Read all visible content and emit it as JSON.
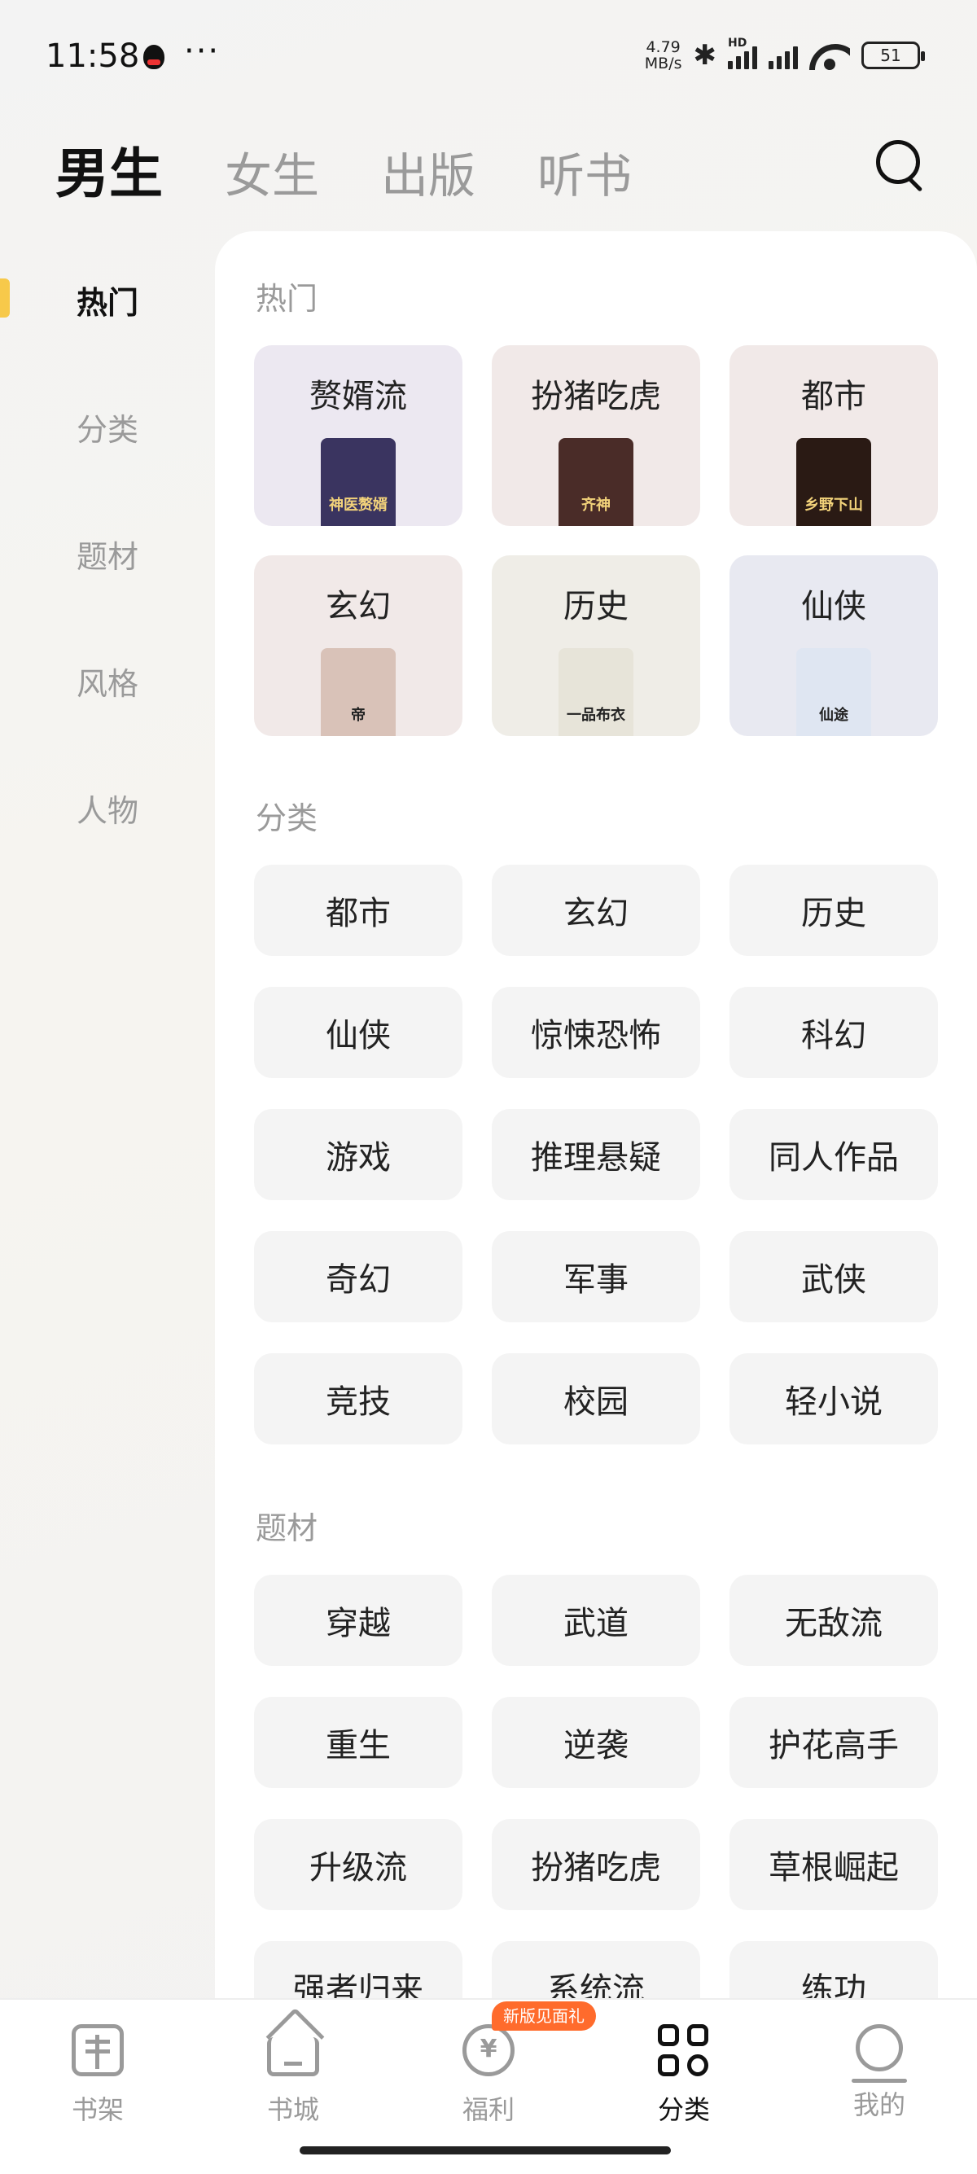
{
  "status_bar": {
    "time": "11:58",
    "dots": "···",
    "net_speed_value": "4.79",
    "net_speed_unit": "MB/s",
    "signal_badge": "HD",
    "battery": "51",
    "icons": [
      "qq-icon",
      "bluetooth-icon",
      "signal-icon",
      "wifi-icon",
      "battery-icon"
    ]
  },
  "channel_tabs": [
    {
      "label": "男生",
      "active": true
    },
    {
      "label": "女生",
      "active": false
    },
    {
      "label": "出版",
      "active": false
    },
    {
      "label": "听书",
      "active": false
    }
  ],
  "side_nav": [
    {
      "label": "热门",
      "active": true
    },
    {
      "label": "分类",
      "active": false
    },
    {
      "label": "题材",
      "active": false
    },
    {
      "label": "风格",
      "active": false
    },
    {
      "label": "人物",
      "active": false
    }
  ],
  "hot": {
    "title": "热门",
    "cards": [
      {
        "label": "赘婿流",
        "bg": "#ece8f1",
        "cover_color": "#3a3460",
        "cover_text": "神医赘婿"
      },
      {
        "label": "扮猪吃虎",
        "bg": "#f1e9e8",
        "cover_color": "#4a2c28",
        "cover_text": "齐神"
      },
      {
        "label": "都市",
        "bg": "#f1e9e8",
        "cover_color": "#2a1a14",
        "cover_text": "乡野下山"
      },
      {
        "label": "玄幻",
        "bg": "#f1e9e8",
        "cover_color": "#d9c2b8",
        "cover_text": "帝"
      },
      {
        "label": "历史",
        "bg": "#efede7",
        "cover_color": "#e7e4d9",
        "cover_text": "一品布衣"
      },
      {
        "label": "仙侠",
        "bg": "#e8e9f1",
        "cover_color": "#dfe6f2",
        "cover_text": "仙途"
      }
    ]
  },
  "category": {
    "title": "分类",
    "items": [
      "都市",
      "玄幻",
      "历史",
      "仙侠",
      "惊悚恐怖",
      "科幻",
      "游戏",
      "推理悬疑",
      "同人作品",
      "奇幻",
      "军事",
      "武侠",
      "竞技",
      "校园",
      "轻小说"
    ]
  },
  "theme": {
    "title": "题材",
    "items": [
      "穿越",
      "武道",
      "无敌流",
      "重生",
      "逆袭",
      "护花高手",
      "升级流",
      "扮猪吃虎",
      "草根崛起",
      "强者归来",
      "系统流",
      "练功"
    ]
  },
  "bottom_nav": [
    {
      "label": "书架",
      "icon": "bookshelf-icon",
      "active": false
    },
    {
      "label": "书城",
      "icon": "bookstore-icon",
      "active": false
    },
    {
      "label": "福利",
      "icon": "welfare-icon",
      "active": false,
      "icon_glyph": "¥"
    },
    {
      "label": "分类",
      "icon": "category-icon",
      "active": true
    },
    {
      "label": "我的",
      "icon": "profile-icon",
      "active": false
    }
  ],
  "welfare_badge": "新版见面礼",
  "colors": {
    "accent": "#f7c94a",
    "badge": "#ff6b2c",
    "tag_bg": "#f4f4f4"
  }
}
